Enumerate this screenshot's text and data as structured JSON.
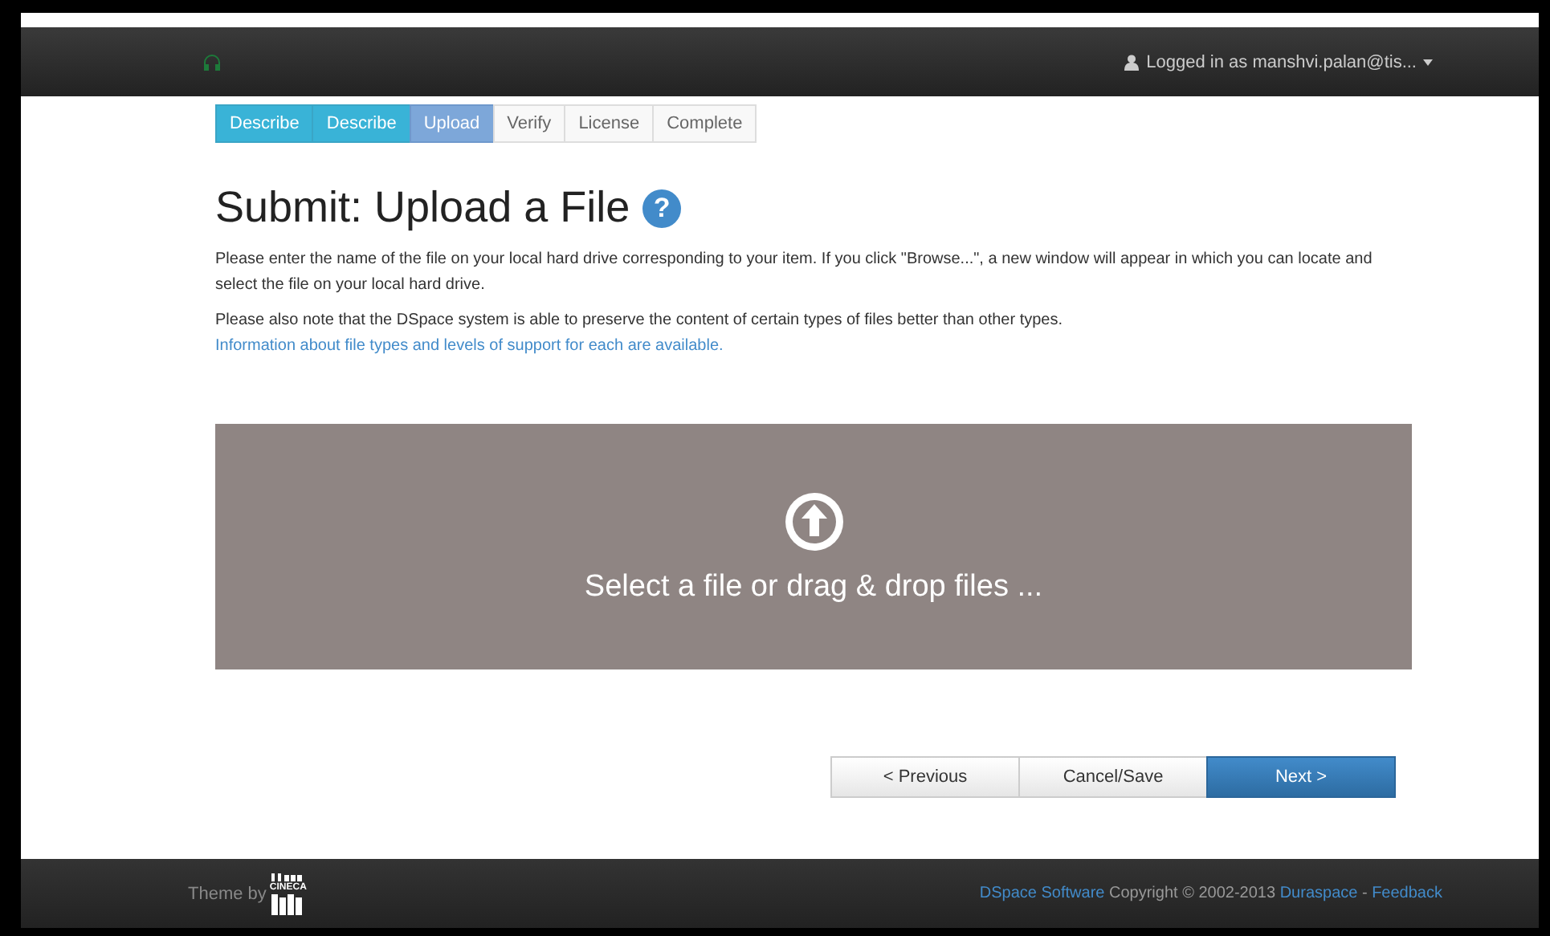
{
  "navbar": {
    "user_menu": "Logged in as manshvi.palan@tis..."
  },
  "steps": [
    {
      "label": "Describe",
      "completed": true,
      "selected": false
    },
    {
      "label": "Describe",
      "completed": true,
      "selected": false
    },
    {
      "label": "Upload",
      "completed": false,
      "selected": true
    },
    {
      "label": "Verify",
      "completed": false,
      "selected": false
    },
    {
      "label": "License",
      "completed": false,
      "selected": false
    },
    {
      "label": "Complete",
      "completed": false,
      "selected": false
    }
  ],
  "title": "Submit: Upload a File",
  "help_badge": "?",
  "paragraphs": [
    {
      "text": "Please enter the name of the file on your local hard drive corresponding to your item. If you click \"Browse...\", a new window will appear in which you can locate and select the file on your local hard drive."
    },
    {
      "text": "Please also note that the DSpace system is able to preserve the content of certain types of files better than other types. ",
      "link": "Information about file types and levels of support for each are available."
    }
  ],
  "dropzone": {
    "label": "Select a file or drag & drop files ..."
  },
  "buttons": [
    {
      "label": "< Previous",
      "kind": "default"
    },
    {
      "label": "Cancel/Save",
      "kind": "default"
    },
    {
      "label": "Next >",
      "kind": "primary"
    }
  ],
  "footer": {
    "theme_by": "Theme by",
    "theme_logo": "CINECA",
    "links": [
      {
        "kind": "link",
        "text": "DSpace Software"
      },
      {
        "kind": "text",
        "text": " Copyright © 2002-2013 "
      },
      {
        "kind": "link",
        "text": "Duraspace"
      },
      {
        "kind": "text",
        "text": " - "
      },
      {
        "kind": "link",
        "text": "Feedback"
      }
    ]
  }
}
